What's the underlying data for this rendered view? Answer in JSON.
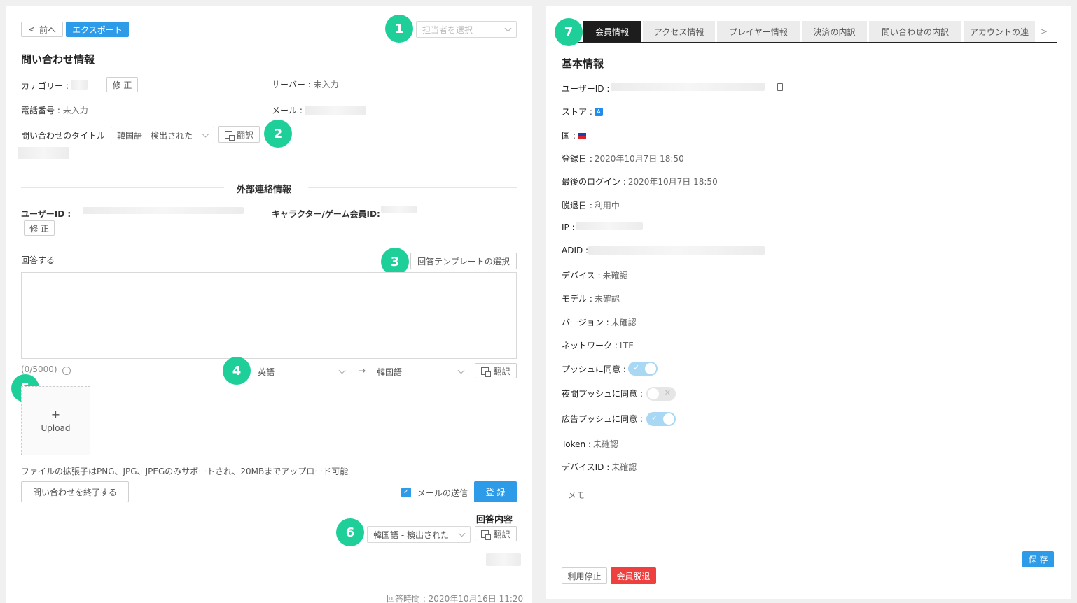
{
  "left": {
    "back_label": "前へ",
    "export_label": "エクスポート",
    "assignee_placeholder": "担当者を選択",
    "section_title": "問い合わせ情報",
    "category_label": "カテゴリー :",
    "edit_label": "修 正",
    "server_label": "サーバー :",
    "server_value": "未入力",
    "phone_label": "電話番号 :",
    "phone_value": "未入力",
    "mail_label": "メール :",
    "inquiry_title_label": "問い合わせのタイトル",
    "detected_language": "韓国語 - 検出された",
    "translate_label": "翻訳",
    "external_title": "外部連絡情報",
    "user_id_label": "ユーザーID :",
    "character_id_label": "キャラクター/ゲーム会員ID:",
    "reply_label": "回答する",
    "template_button": "回答テンプレートの選択",
    "char_count": "(0/5000)",
    "source_language": "英語",
    "arrow": "→",
    "target_language": "韓国語",
    "upload_plus": "+",
    "upload_label": "Upload",
    "file_note": "ファイルの拡張子はPNG、JPG、JPEGのみサポートされ、20MBまでアップロード可能",
    "close_inquiry_button": "問い合わせを終了する",
    "send_mail_label": "メールの送信",
    "register_button": "登 録",
    "reply_content_title": "回答内容",
    "reply_time": "回答時間 : 2020年10月16日 11:20"
  },
  "badges": [
    "1",
    "2",
    "3",
    "4",
    "5",
    "6",
    "7"
  ],
  "right": {
    "tabs": [
      "会員情報",
      "アクセス情報",
      "プレイヤー情報",
      "決済の内訳",
      "問い合わせの内訳",
      "アカウントの連"
    ],
    "tab_more": ">",
    "section_title": "基本情報",
    "rows": {
      "user_id": "ユーザーID :",
      "store": "ストア :",
      "country": "国 :",
      "registered_label": "登録日 :",
      "registered_value": "2020年10月7日 18:50",
      "last_login_label": "最後のログイン :",
      "last_login_value": "2020年10月7日 18:50",
      "withdraw_label": "脱退日 :",
      "withdraw_value": "利用中",
      "ip": "IP :",
      "adid": "ADID :",
      "device_label": "デバイス :",
      "device_value": "未確認",
      "model_label": "モデル :",
      "model_value": "未確認",
      "version_label": "バージョン :",
      "version_value": "未確認",
      "network_label": "ネットワーク :",
      "network_value": "LTE",
      "push_label": "プッシュに同意 :",
      "night_push_label": "夜間プッシュに同意 :",
      "ad_push_label": "広告プッシュに同意 :",
      "token_label": "Token :",
      "token_value": "未確認",
      "device_id_label": "デバイスID :",
      "device_id_value": "未確認"
    },
    "toggles": {
      "push": true,
      "night_push": false,
      "ad_push": true
    },
    "memo_placeholder": "メモ",
    "save_button": "保 存",
    "suspend_button": "利用停止",
    "withdraw_button": "会員脱退"
  }
}
